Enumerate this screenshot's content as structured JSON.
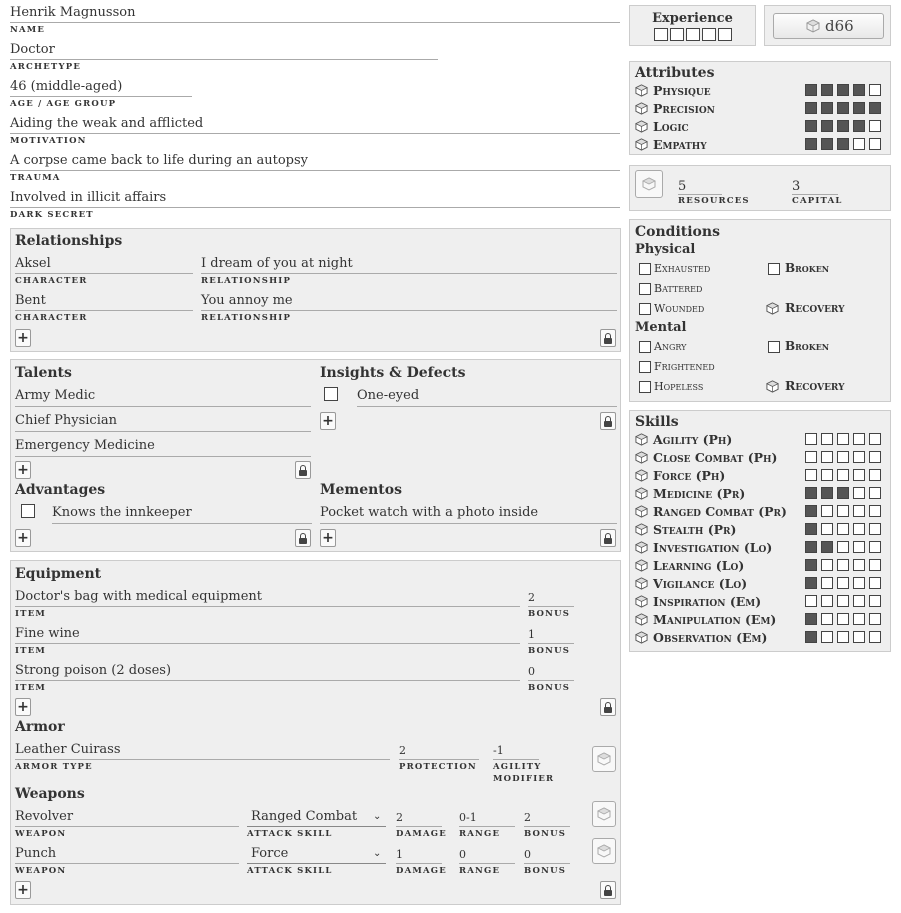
{
  "identity": {
    "name": {
      "value": "Henrik Magnusson",
      "label": "Name"
    },
    "archetype": {
      "value": "Doctor",
      "label": "Archetype"
    },
    "age": {
      "value": "46 (middle-aged)",
      "label": "Age / Age Group"
    },
    "motivation": {
      "value": "Aiding the weak and afflicted",
      "label": "Motivation"
    },
    "trauma": {
      "value": "A corpse came back to life during an autopsy",
      "label": "Trauma"
    },
    "dark_secret": {
      "value": "Involved in illicit affairs",
      "label": "Dark Secret"
    }
  },
  "experience": {
    "title": "Experience",
    "boxes": 5
  },
  "roller": {
    "label": "d66"
  },
  "attributes": {
    "title": "Attributes",
    "items": [
      {
        "name": "Physique",
        "value": 4,
        "max": 5
      },
      {
        "name": "Precision",
        "value": 5,
        "max": 5
      },
      {
        "name": "Logic",
        "value": 4,
        "max": 5
      },
      {
        "name": "Empathy",
        "value": 3,
        "max": 5
      }
    ]
  },
  "wealth": {
    "resources": {
      "value": "5",
      "label": "Resources"
    },
    "capital": {
      "value": "3",
      "label": "Capital"
    }
  },
  "conditions": {
    "title": "Conditions",
    "physical_title": "Physical",
    "mental_title": "Mental",
    "physical": [
      "Exhausted",
      "Battered",
      "Wounded"
    ],
    "physical_broken": "Broken",
    "mental": [
      "Angry",
      "Frightened",
      "Hopeless"
    ],
    "mental_broken": "Broken",
    "recovery": "Recovery"
  },
  "skills": {
    "title": "Skills",
    "items": [
      {
        "name": "Agility (Ph)",
        "value": 0
      },
      {
        "name": "Close Combat (Ph)",
        "value": 0
      },
      {
        "name": "Force (Ph)",
        "value": 0
      },
      {
        "name": "Medicine (Pr)",
        "value": 3
      },
      {
        "name": "Ranged Combat (Pr)",
        "value": 1
      },
      {
        "name": "Stealth (Pr)",
        "value": 1
      },
      {
        "name": "Investigation (Lo)",
        "value": 2
      },
      {
        "name": "Learning (Lo)",
        "value": 1
      },
      {
        "name": "Vigilance (Lo)",
        "value": 1
      },
      {
        "name": "Inspiration (Em)",
        "value": 0
      },
      {
        "name": "Manipulation (Em)",
        "value": 1
      },
      {
        "name": "Observation (Em)",
        "value": 1
      }
    ]
  },
  "relationships": {
    "title": "Relationships",
    "character_label": "Character",
    "relationship_label": "Relationship",
    "items": [
      {
        "character": "Aksel",
        "relationship": "I dream of you at night"
      },
      {
        "character": "Bent",
        "relationship": "You annoy me"
      }
    ]
  },
  "talents": {
    "title": "Talents",
    "items": [
      "Army Medic",
      "Chief Physician",
      "Emergency Medicine"
    ]
  },
  "insights": {
    "title": "Insights & Defects",
    "items": [
      "One-eyed"
    ]
  },
  "advantages": {
    "title": "Advantages",
    "items": [
      "Knows the innkeeper"
    ]
  },
  "mementos": {
    "title": "Mementos",
    "items": [
      "Pocket watch with a photo inside"
    ]
  },
  "equipment": {
    "title": "Equipment",
    "item_label": "Item",
    "bonus_label": "Bonus",
    "items": [
      {
        "item": "Doctor's bag with medical equipment",
        "bonus": "2"
      },
      {
        "item": "Fine wine",
        "bonus": "1"
      },
      {
        "item": "Strong poison (2 doses)",
        "bonus": "0"
      }
    ]
  },
  "armor": {
    "title": "Armor",
    "type": "Leather Cuirass",
    "type_label": "Armor Type",
    "protection": "2",
    "protection_label": "Protection",
    "agility": "-1",
    "agility_label_1": "Agility",
    "agility_label_2": "Modifier"
  },
  "weapons": {
    "title": "Weapons",
    "weapon_label": "Weapon",
    "skill_label": "Attack Skill",
    "damage_label": "Damage",
    "range_label": "Range",
    "bonus_label": "Bonus",
    "items": [
      {
        "weapon": "Revolver",
        "skill": "Ranged Combat",
        "damage": "2",
        "range": "0-1",
        "bonus": "2"
      },
      {
        "weapon": "Punch",
        "skill": "Force",
        "damage": "1",
        "range": "0",
        "bonus": "0"
      }
    ]
  }
}
